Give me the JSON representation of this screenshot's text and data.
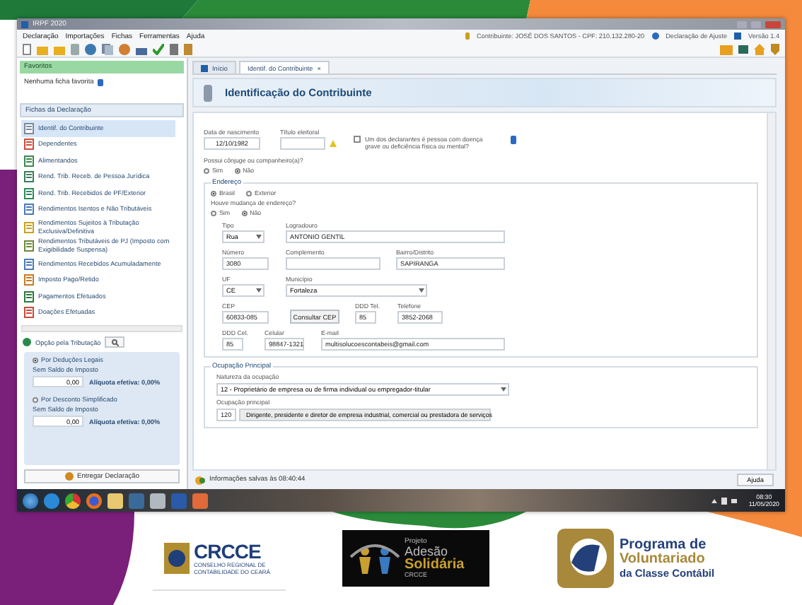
{
  "window": {
    "title": "IRPF 2020"
  },
  "menu": [
    "Declaração",
    "Importações",
    "Fichas",
    "Ferramentas",
    "Ajuda"
  ],
  "header_info": {
    "contributor": "Contribuinte: JOSÉ DOS SANTOS - CPF: 210.132.280-20",
    "mode": "Declaração de Ajuste",
    "version": "Versão 1.4"
  },
  "sidebar": {
    "favorites_title": "Favoritos",
    "favorites_empty": "Nenhuma ficha favorita",
    "fichas_title": "Fichas da Declaração",
    "items": [
      {
        "label": "Identif. do Contribuinte",
        "selected": true
      },
      {
        "label": "Dependentes",
        "selected": false
      },
      {
        "label": "Alimentandos",
        "selected": false
      },
      {
        "label": "Rend. Trib. Receb. de Pessoa Jurídica",
        "selected": false
      },
      {
        "label": "Rend. Trib. Recebidos de PF/Exterior",
        "selected": false
      },
      {
        "label": "Rendimentos Isentos e Não Tributáveis",
        "selected": false
      },
      {
        "label": "Rendimentos Sujeitos à Tributação Exclusiva/Definitiva",
        "selected": false
      },
      {
        "label": "Rendimentos Tributáveis de PJ (Imposto com Exigibilidade Suspensa)",
        "selected": false
      },
      {
        "label": "Rendimentos Recebidos Acumuladamente",
        "selected": false
      },
      {
        "label": "Imposto Pago/Retido",
        "selected": false
      },
      {
        "label": "Pagamentos Efetuados",
        "selected": false
      },
      {
        "label": "Doações Efetuadas",
        "selected": false
      }
    ]
  },
  "tax_option": {
    "title": "Opção pela Tributação",
    "options": [
      {
        "label": "Por Deduções Legais",
        "selected": true,
        "status": "Sem Saldo de Imposto",
        "value": "0,00",
        "rate": "Alíquota efetiva: 0,00%"
      },
      {
        "label": "Por Desconto Simplificado",
        "selected": false,
        "status": "Sem Saldo de Imposto",
        "value": "0,00",
        "rate": "Alíquota efetiva: 0,00%"
      }
    ],
    "submit": "Entregar Declaração"
  },
  "tabs": [
    {
      "label": "Início",
      "selected": false
    },
    {
      "label": "Identif. do Contribuinte",
      "selected": true,
      "close": "×"
    }
  ],
  "page_title": "Identificação do Contribuinte",
  "form": {
    "birth_date": {
      "label": "Data de nascimento",
      "value": "12/10/1982"
    },
    "voter_id": {
      "label": "Título eleitoral"
    },
    "disability": {
      "label": "Um dos declarantes é pessoa com doença grave ou deficiência física ou mental?",
      "checked": false
    },
    "spouse": {
      "question": "Possui cônjuge ou companheiro(a)?",
      "options": [
        {
          "label": "Sim",
          "selected": false
        },
        {
          "label": "Não",
          "selected": true
        }
      ]
    }
  },
  "address": {
    "title": "Endereço",
    "location": [
      {
        "label": "Brasil",
        "selected": true
      },
      {
        "label": "Exterior",
        "selected": false
      }
    ],
    "moved": {
      "question": "Houve mudança de endereço?",
      "options": [
        {
          "label": "Sim",
          "selected": false
        },
        {
          "label": "Não",
          "selected": true
        }
      ]
    },
    "rows": [
      [
        {
          "kind": "select",
          "label": "Tipo",
          "value": "Rua"
        },
        {
          "kind": "input",
          "label": "Logradouro",
          "value": "ANTONIO GENTIL"
        }
      ],
      [
        {
          "kind": "input",
          "label": "Número",
          "value": "3080"
        },
        {
          "kind": "input",
          "label": "Complemento"
        },
        {
          "kind": "input",
          "label": "Bairro/Distrito",
          "value": "SAPIRANGA"
        }
      ],
      [
        {
          "kind": "select",
          "label": "UF",
          "value": "CE"
        },
        {
          "kind": "select",
          "label": "Município",
          "value": "Fortaleza"
        }
      ],
      [
        {
          "kind": "input",
          "label": "CEP",
          "value": "60833-085"
        },
        {
          "kind": "button",
          "value": "Consultar CEP"
        },
        {
          "kind": "input",
          "label": "DDD Tel.",
          "value": "85"
        },
        {
          "kind": "input",
          "label": "Telefone",
          "value": "3852-2068"
        }
      ],
      [
        {
          "kind": "input",
          "label": "DDD Cel.",
          "value": "85"
        },
        {
          "kind": "input",
          "label": "Celular",
          "value": "98847-1321"
        },
        {
          "kind": "input",
          "label": "E-mail",
          "value": "multisolucoescontabeis@gmail.com"
        }
      ]
    ]
  },
  "occupation": {
    "title": "Ocupação Principal",
    "nature_label": "Natureza da ocupação",
    "nature": "12 - Proprietário de empresa ou de firma individual ou empregador-titular",
    "main_label": "Ocupação principal",
    "main_code": "120",
    "main": "Dirigente, presidente e diretor de empresa industrial, comercial ou prestadora de serviços"
  },
  "status_bar": {
    "message": "Informações salvas às 08:40:44",
    "help": "Ajuda"
  },
  "taskbar": {
    "time": "08:30",
    "date": "11/05/2020"
  },
  "logos": {
    "crcce": {
      "name": "CRCCE",
      "subtitle": "CONSELHO REGIONAL DE CONTABILIDADE DO CEARÁ"
    },
    "adesao": {
      "lines": [
        "Projeto",
        "Adesão",
        "Solidária",
        "CRCCE"
      ]
    },
    "programa": {
      "lines": [
        "Programa de",
        "Voluntariado",
        "da Classe Contábil"
      ]
    }
  }
}
